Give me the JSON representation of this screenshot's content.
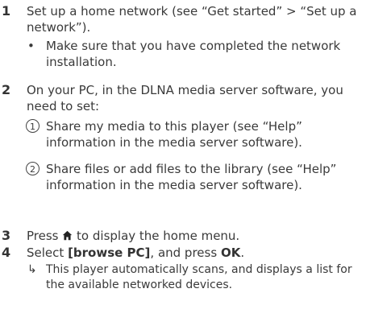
{
  "steps": [
    {
      "number": "1",
      "text": "Set up a home network (see “Get started” > “Set up a network”).",
      "bullet": {
        "glyph": "•",
        "text": "Make sure that you have completed the network installation."
      }
    },
    {
      "number": "2",
      "text": "On your PC, in the DLNA media server software, you need to set:",
      "substeps": [
        {
          "marker": "1",
          "text": "Share my media to this player (see “Help” information in the media server software)."
        },
        {
          "marker": "2",
          "text": "Share files or add files to the library (see “Help” information in the media server software)."
        }
      ]
    },
    {
      "number": "3",
      "text_before": "Press",
      "icon": "home-icon",
      "text_after": "to display the home menu."
    },
    {
      "number": "4",
      "text_before": "Select",
      "ui_option": "[browse PC]",
      "text_middle": ", and press",
      "button": "OK",
      "text_after": ".",
      "result": {
        "glyph": "↳",
        "text": "This player automatically scans, and displays a list for the available networked devices."
      }
    }
  ]
}
